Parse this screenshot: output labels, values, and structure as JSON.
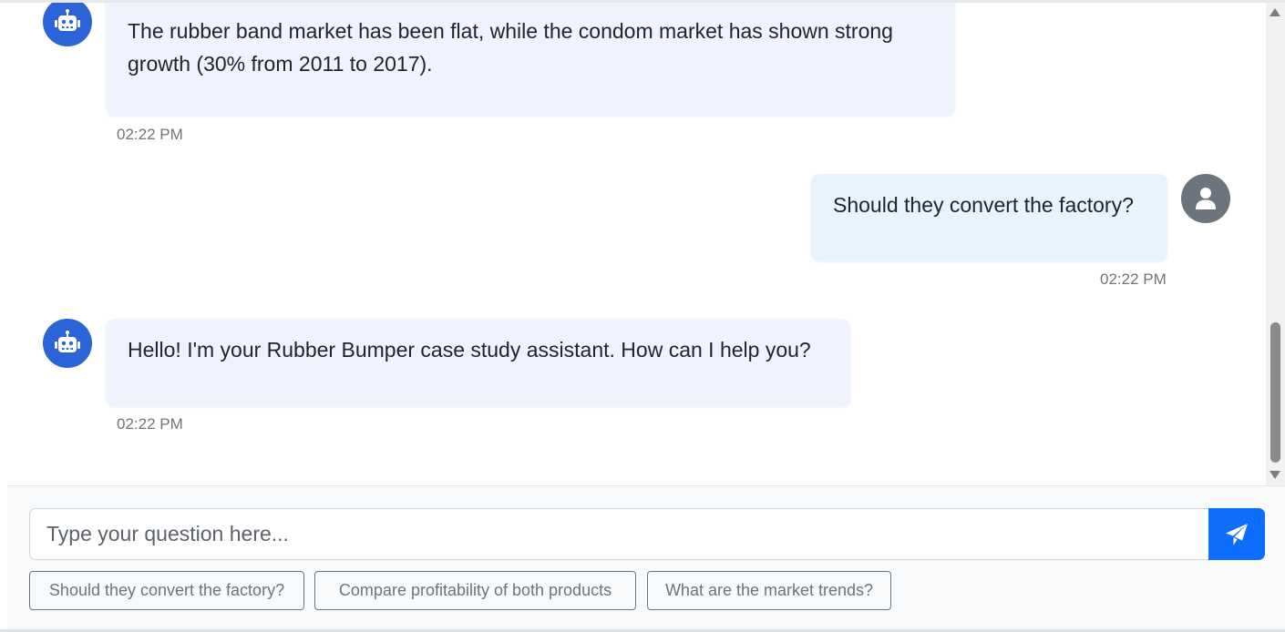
{
  "messages": [
    {
      "role": "bot",
      "text": "The rubber band market has been flat, while the condom market has shown strong growth (30% from 2011 to 2017).",
      "time": "02:22 PM"
    },
    {
      "role": "user",
      "text": "Should they convert the factory?",
      "time": "02:22 PM"
    },
    {
      "role": "bot",
      "text": "Hello! I'm your Rubber Bumper case study assistant. How can I help you?",
      "time": "02:22 PM"
    }
  ],
  "input": {
    "placeholder": "Type your question here...",
    "value": ""
  },
  "suggestions": [
    "Should they convert the factory?",
    "Compare profitability of both products",
    "What are the market trends?"
  ],
  "icons": {
    "bot_avatar": "robot-icon",
    "user_avatar": "user-icon",
    "send": "paper-plane-icon"
  },
  "colors": {
    "bot_avatar": "#2a64d7",
    "user_avatar": "#6c757d",
    "bot_bubble": "#eef3fe",
    "user_bubble": "#e7f3fd",
    "send_button": "#0d6efd"
  }
}
